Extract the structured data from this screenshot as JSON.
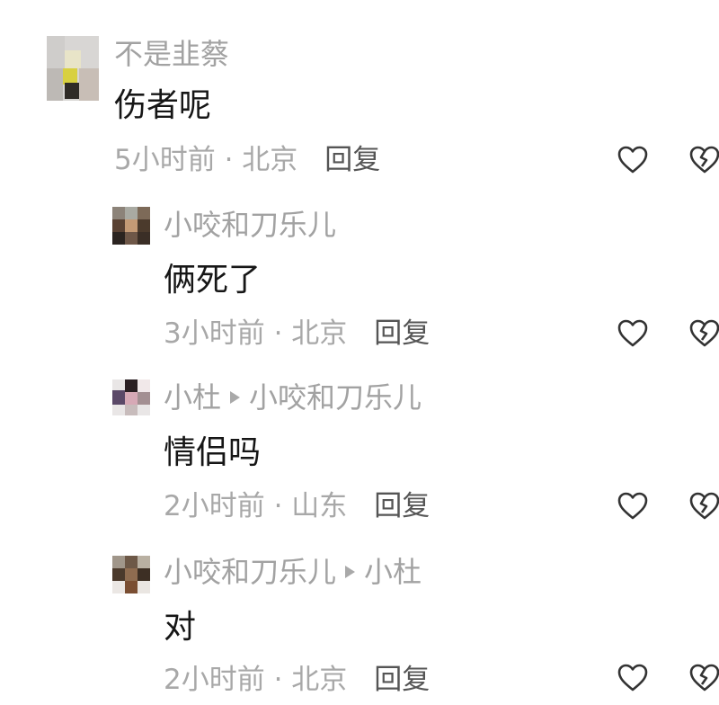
{
  "comments": [
    {
      "username": "不是韭蔡",
      "content": "伤者呢",
      "meta": "5小时前 · 北京",
      "reply_label": "回复"
    },
    {
      "username": "小咬和刀乐儿",
      "content": "俩死了",
      "meta": "3小时前 · 北京",
      "reply_label": "回复"
    },
    {
      "username": "小杜",
      "reply_to": "小咬和刀乐儿",
      "content": "情侣吗",
      "meta": "2小时前 · 山东",
      "reply_label": "回复"
    },
    {
      "username": "小咬和刀乐儿",
      "reply_to": "小杜",
      "content": "对",
      "meta": "2小时前 · 北京",
      "reply_label": "回复"
    }
  ],
  "icons": {
    "like": "heart-outline-icon",
    "dislike": "broken-heart-icon"
  },
  "colors": {
    "username": "#a2a2a2",
    "content": "#161616",
    "meta": "#a8a8a8",
    "reply": "#555555",
    "icon": "#333333"
  }
}
